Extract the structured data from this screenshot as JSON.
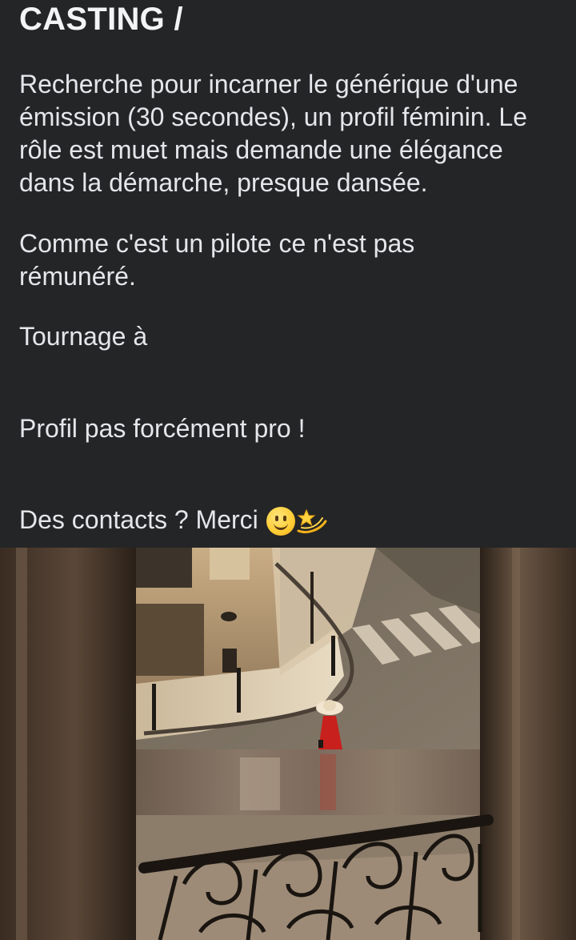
{
  "post": {
    "title": "CASTING /",
    "paragraph_1_line_1": "Recherche pour incarner le générique d'une",
    "paragraph_1_line_2": "émission (30 secondes), un profil féminin. Le",
    "paragraph_1_line_3": "rôle est muet mais demande une élégance",
    "paragraph_1_line_4": "dans la démarche, presque dansée.",
    "paragraph_2_line_1": "Comme c'est un pilote ce n'est pas",
    "paragraph_2_line_2": "rémunéré.",
    "paragraph_3": "Tournage à",
    "paragraph_4": "Profil pas forcément pro !",
    "paragraph_5": "Des contacts ? Merci",
    "emojis": [
      "smiling-face-icon",
      "dizzy-star-icon"
    ]
  },
  "photo": {
    "subject": "woman-in-red-dress-street-from-balcony",
    "colors": {
      "dress": "#c8201c",
      "hat": "#f2e6d0",
      "street": "#8a7a68",
      "wall": "#b89c74",
      "frame": "#3a2d24"
    }
  }
}
